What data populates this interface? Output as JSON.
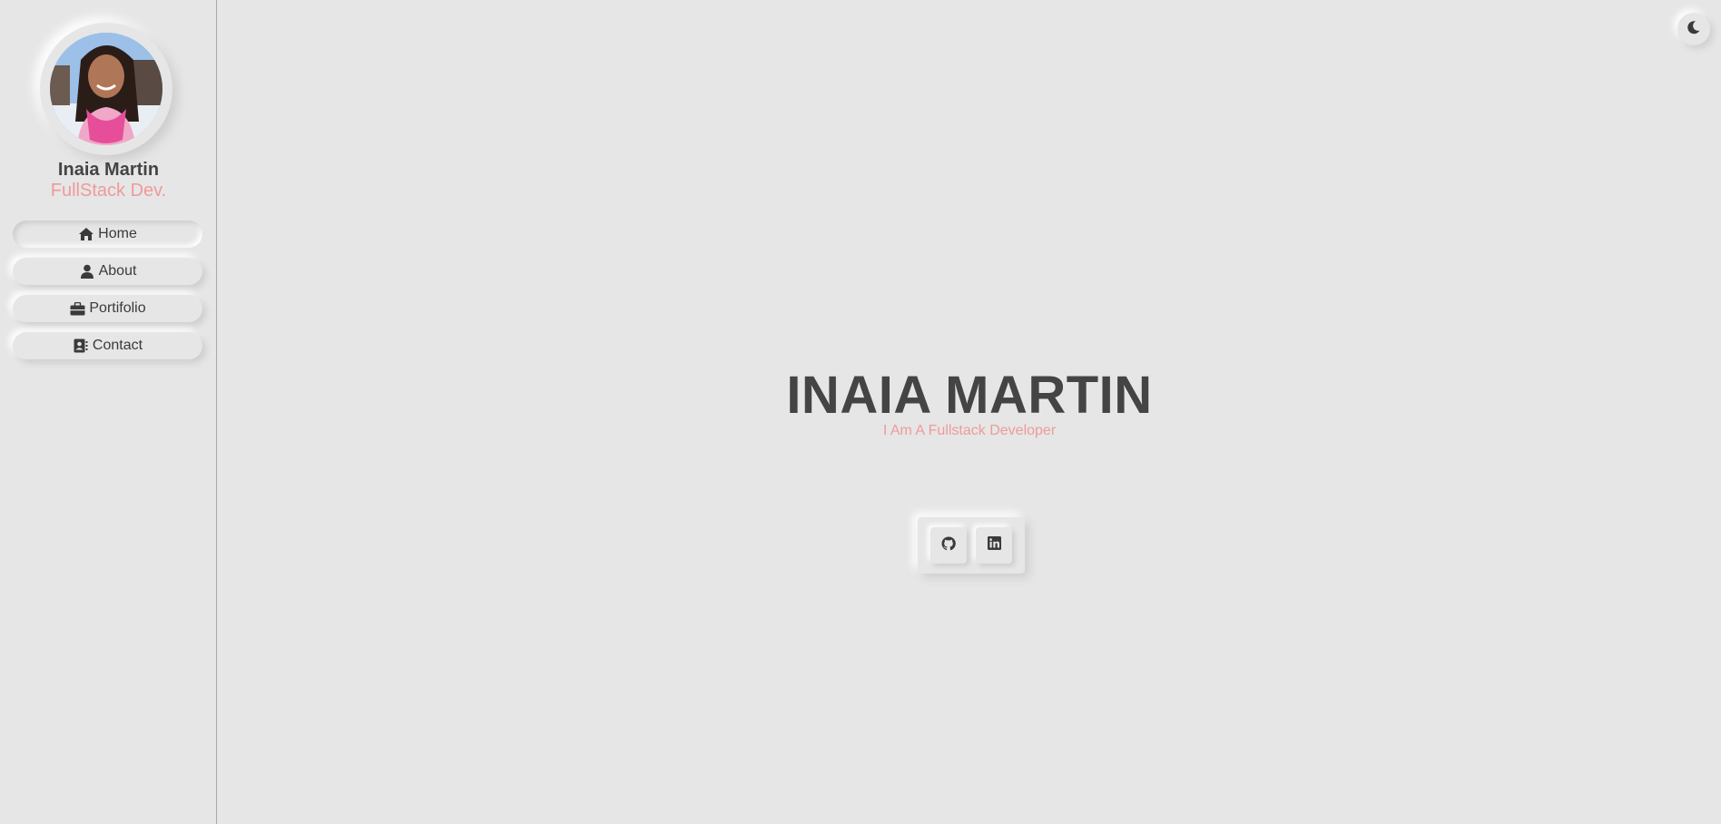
{
  "profile": {
    "name": "Inaia Martin",
    "role": "FullStack Dev."
  },
  "nav": {
    "items": [
      {
        "label": "Home",
        "icon": "home-icon",
        "active": true
      },
      {
        "label": "About",
        "icon": "user-icon",
        "active": false
      },
      {
        "label": "Portifolio",
        "icon": "briefcase-icon",
        "active": false
      },
      {
        "label": "Contact",
        "icon": "address-book-icon",
        "active": false
      }
    ]
  },
  "theme_toggle": {
    "icon": "moon-icon"
  },
  "hero": {
    "title": "INAIA MARTIN",
    "subtitle": "I Am A Fullstack Developer"
  },
  "social": [
    {
      "icon": "github-icon"
    },
    {
      "icon": "linkedin-icon"
    }
  ],
  "colors": {
    "background": "#e6e6e6",
    "text": "#444444",
    "accent": "#ef9a9a"
  }
}
